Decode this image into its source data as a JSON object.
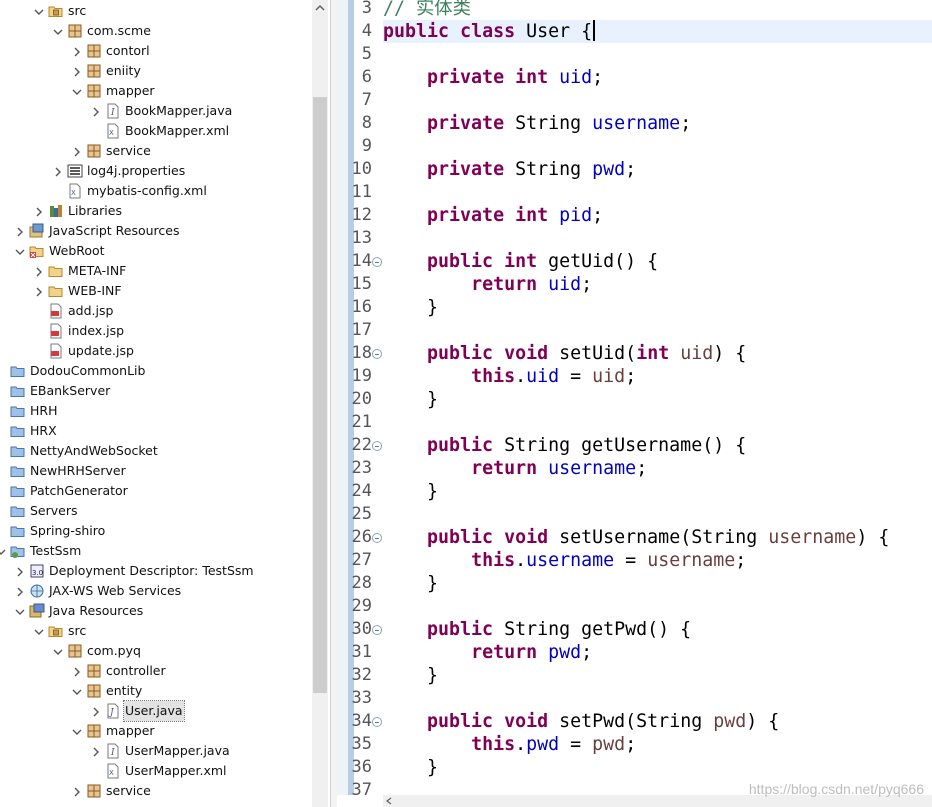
{
  "explorer": {
    "rows": [
      {
        "label": "src",
        "icon": "package-folder",
        "expanded": true,
        "depth": 2
      },
      {
        "label": "com.scme",
        "icon": "package",
        "expanded": true,
        "depth": 3
      },
      {
        "label": "contorl",
        "icon": "package",
        "expanded": false,
        "depth": 4
      },
      {
        "label": "eniity",
        "icon": "package",
        "expanded": false,
        "depth": 4
      },
      {
        "label": "mapper",
        "icon": "package",
        "expanded": true,
        "depth": 4
      },
      {
        "label": "BookMapper.java",
        "icon": "java-interface-file",
        "expanded": false,
        "depth": 5
      },
      {
        "label": "BookMapper.xml",
        "icon": "xml-file",
        "expanded": null,
        "depth": 5
      },
      {
        "label": "service",
        "icon": "package",
        "expanded": false,
        "depth": 4
      },
      {
        "label": "log4j.properties",
        "icon": "properties-file",
        "expanded": false,
        "depth": 3
      },
      {
        "label": "mybatis-config.xml",
        "icon": "xml-file",
        "expanded": null,
        "depth": 3
      },
      {
        "label": "Libraries",
        "icon": "libraries",
        "expanded": false,
        "depth": 2
      },
      {
        "label": "JavaScript Resources",
        "icon": "javascript-resources",
        "expanded": false,
        "depth": 1
      },
      {
        "label": "WebRoot",
        "icon": "folder-error",
        "expanded": true,
        "depth": 1
      },
      {
        "label": "META-INF",
        "icon": "folder",
        "expanded": false,
        "depth": 2
      },
      {
        "label": "WEB-INF",
        "icon": "folder",
        "expanded": false,
        "depth": 2
      },
      {
        "label": "add.jsp",
        "icon": "jsp-file",
        "expanded": null,
        "depth": 2
      },
      {
        "label": "index.jsp",
        "icon": "jsp-file",
        "expanded": null,
        "depth": 2
      },
      {
        "label": "update.jsp",
        "icon": "jsp-file",
        "expanded": null,
        "depth": 2
      },
      {
        "label": "DodouCommonLib",
        "icon": "project",
        "expanded": null,
        "depth": 0
      },
      {
        "label": "EBankServer",
        "icon": "project",
        "expanded": null,
        "depth": 0
      },
      {
        "label": "HRH",
        "icon": "project",
        "expanded": null,
        "depth": 0
      },
      {
        "label": "HRX",
        "icon": "project",
        "expanded": null,
        "depth": 0
      },
      {
        "label": "NettyAndWebSocket",
        "icon": "project",
        "expanded": null,
        "depth": 0
      },
      {
        "label": "NewHRHServer",
        "icon": "project",
        "expanded": null,
        "depth": 0
      },
      {
        "label": "PatchGenerator",
        "icon": "project",
        "expanded": null,
        "depth": 0
      },
      {
        "label": "Servers",
        "icon": "project",
        "expanded": null,
        "depth": 0
      },
      {
        "label": "Spring-shiro",
        "icon": "project",
        "expanded": null,
        "depth": 0
      },
      {
        "label": "TestSsm",
        "icon": "web-project",
        "expanded": true,
        "depth": 0
      },
      {
        "label": "Deployment Descriptor: TestSsm",
        "icon": "deployment-descriptor",
        "expanded": false,
        "depth": 1
      },
      {
        "label": "JAX-WS Web Services",
        "icon": "web-services",
        "expanded": false,
        "depth": 1
      },
      {
        "label": "Java Resources",
        "icon": "java-resources",
        "expanded": true,
        "depth": 1
      },
      {
        "label": "src",
        "icon": "package-folder",
        "expanded": true,
        "depth": 2
      },
      {
        "label": "com.pyq",
        "icon": "package",
        "expanded": true,
        "depth": 3
      },
      {
        "label": "controller",
        "icon": "package",
        "expanded": false,
        "depth": 4
      },
      {
        "label": "entity",
        "icon": "package",
        "expanded": true,
        "depth": 4
      },
      {
        "label": "User.java",
        "icon": "java-file",
        "expanded": false,
        "depth": 5,
        "selected": true
      },
      {
        "label": "mapper",
        "icon": "package",
        "expanded": true,
        "depth": 4
      },
      {
        "label": "UserMapper.java",
        "icon": "java-interface-file",
        "expanded": false,
        "depth": 5
      },
      {
        "label": "UserMapper.xml",
        "icon": "xml-file",
        "expanded": null,
        "depth": 5
      },
      {
        "label": "service",
        "icon": "package",
        "expanded": false,
        "depth": 4
      }
    ]
  },
  "editor": {
    "cursor_line": 4,
    "lines": [
      {
        "n": 3,
        "fold": false,
        "tokens": [
          [
            "cm",
            "// 实体类"
          ]
        ]
      },
      {
        "n": 4,
        "fold": false,
        "tokens": [
          [
            "kw",
            "public"
          ],
          [
            "t",
            " "
          ],
          [
            "kw",
            "class"
          ],
          [
            "t",
            " User {"
          ]
        ]
      },
      {
        "n": 5,
        "fold": false,
        "tokens": []
      },
      {
        "n": 6,
        "fold": false,
        "tokens": [
          [
            "t",
            "    "
          ],
          [
            "kw",
            "private"
          ],
          [
            "t",
            " "
          ],
          [
            "kw",
            "int"
          ],
          [
            "t",
            " "
          ],
          [
            "fd",
            "uid"
          ],
          [
            "t",
            ";"
          ]
        ]
      },
      {
        "n": 7,
        "fold": false,
        "tokens": []
      },
      {
        "n": 8,
        "fold": false,
        "tokens": [
          [
            "t",
            "    "
          ],
          [
            "kw",
            "private"
          ],
          [
            "t",
            " String "
          ],
          [
            "fd",
            "username"
          ],
          [
            "t",
            ";"
          ]
        ]
      },
      {
        "n": 9,
        "fold": false,
        "tokens": []
      },
      {
        "n": 10,
        "fold": false,
        "tokens": [
          [
            "t",
            "    "
          ],
          [
            "kw",
            "private"
          ],
          [
            "t",
            " String "
          ],
          [
            "fd",
            "pwd"
          ],
          [
            "t",
            ";"
          ]
        ]
      },
      {
        "n": 11,
        "fold": false,
        "tokens": []
      },
      {
        "n": 12,
        "fold": false,
        "tokens": [
          [
            "t",
            "    "
          ],
          [
            "kw",
            "private"
          ],
          [
            "t",
            " "
          ],
          [
            "kw",
            "int"
          ],
          [
            "t",
            " "
          ],
          [
            "fd",
            "pid"
          ],
          [
            "t",
            ";"
          ]
        ]
      },
      {
        "n": 13,
        "fold": false,
        "tokens": []
      },
      {
        "n": 14,
        "fold": true,
        "tokens": [
          [
            "t",
            "    "
          ],
          [
            "kw",
            "public"
          ],
          [
            "t",
            " "
          ],
          [
            "kw",
            "int"
          ],
          [
            "t",
            " getUid() {"
          ]
        ]
      },
      {
        "n": 15,
        "fold": false,
        "tokens": [
          [
            "t",
            "        "
          ],
          [
            "kw",
            "return"
          ],
          [
            "t",
            " "
          ],
          [
            "fd",
            "uid"
          ],
          [
            "t",
            ";"
          ]
        ]
      },
      {
        "n": 16,
        "fold": false,
        "tokens": [
          [
            "t",
            "    }"
          ]
        ]
      },
      {
        "n": 17,
        "fold": false,
        "tokens": []
      },
      {
        "n": 18,
        "fold": true,
        "tokens": [
          [
            "t",
            "    "
          ],
          [
            "kw",
            "public"
          ],
          [
            "t",
            " "
          ],
          [
            "kw",
            "void"
          ],
          [
            "t",
            " setUid("
          ],
          [
            "kw",
            "int"
          ],
          [
            "t",
            " "
          ],
          [
            "pm",
            "uid"
          ],
          [
            "t",
            ") {"
          ]
        ]
      },
      {
        "n": 19,
        "fold": false,
        "tokens": [
          [
            "t",
            "        "
          ],
          [
            "kw",
            "this"
          ],
          [
            "t",
            "."
          ],
          [
            "fd",
            "uid"
          ],
          [
            "t",
            " = "
          ],
          [
            "pm",
            "uid"
          ],
          [
            "t",
            ";"
          ]
        ]
      },
      {
        "n": 20,
        "fold": false,
        "tokens": [
          [
            "t",
            "    }"
          ]
        ]
      },
      {
        "n": 21,
        "fold": false,
        "tokens": []
      },
      {
        "n": 22,
        "fold": true,
        "tokens": [
          [
            "t",
            "    "
          ],
          [
            "kw",
            "public"
          ],
          [
            "t",
            " String getUsername() {"
          ]
        ]
      },
      {
        "n": 23,
        "fold": false,
        "tokens": [
          [
            "t",
            "        "
          ],
          [
            "kw",
            "return"
          ],
          [
            "t",
            " "
          ],
          [
            "fd",
            "username"
          ],
          [
            "t",
            ";"
          ]
        ]
      },
      {
        "n": 24,
        "fold": false,
        "tokens": [
          [
            "t",
            "    }"
          ]
        ]
      },
      {
        "n": 25,
        "fold": false,
        "tokens": []
      },
      {
        "n": 26,
        "fold": true,
        "tokens": [
          [
            "t",
            "    "
          ],
          [
            "kw",
            "public"
          ],
          [
            "t",
            " "
          ],
          [
            "kw",
            "void"
          ],
          [
            "t",
            " setUsername(String "
          ],
          [
            "pm",
            "username"
          ],
          [
            "t",
            ") {"
          ]
        ]
      },
      {
        "n": 27,
        "fold": false,
        "tokens": [
          [
            "t",
            "        "
          ],
          [
            "kw",
            "this"
          ],
          [
            "t",
            "."
          ],
          [
            "fd",
            "username"
          ],
          [
            "t",
            " = "
          ],
          [
            "pm",
            "username"
          ],
          [
            "t",
            ";"
          ]
        ]
      },
      {
        "n": 28,
        "fold": false,
        "tokens": [
          [
            "t",
            "    }"
          ]
        ]
      },
      {
        "n": 29,
        "fold": false,
        "tokens": []
      },
      {
        "n": 30,
        "fold": true,
        "tokens": [
          [
            "t",
            "    "
          ],
          [
            "kw",
            "public"
          ],
          [
            "t",
            " String getPwd() {"
          ]
        ]
      },
      {
        "n": 31,
        "fold": false,
        "tokens": [
          [
            "t",
            "        "
          ],
          [
            "kw",
            "return"
          ],
          [
            "t",
            " "
          ],
          [
            "fd",
            "pwd"
          ],
          [
            "t",
            ";"
          ]
        ]
      },
      {
        "n": 32,
        "fold": false,
        "tokens": [
          [
            "t",
            "    }"
          ]
        ]
      },
      {
        "n": 33,
        "fold": false,
        "tokens": []
      },
      {
        "n": 34,
        "fold": true,
        "tokens": [
          [
            "t",
            "    "
          ],
          [
            "kw",
            "public"
          ],
          [
            "t",
            " "
          ],
          [
            "kw",
            "void"
          ],
          [
            "t",
            " setPwd(String "
          ],
          [
            "pm",
            "pwd"
          ],
          [
            "t",
            ") {"
          ]
        ]
      },
      {
        "n": 35,
        "fold": false,
        "tokens": [
          [
            "t",
            "        "
          ],
          [
            "kw",
            "this"
          ],
          [
            "t",
            "."
          ],
          [
            "fd",
            "pwd"
          ],
          [
            "t",
            " = "
          ],
          [
            "pm",
            "pwd"
          ],
          [
            "t",
            ";"
          ]
        ]
      },
      {
        "n": 36,
        "fold": false,
        "tokens": [
          [
            "t",
            "    }"
          ]
        ]
      },
      {
        "n": 37,
        "fold": false,
        "tokens": []
      }
    ]
  },
  "watermark": "https://blog.csdn.net/pyq666",
  "colors": {
    "keyword": "#7f0055",
    "field": "#0000c0",
    "param": "#6a3e3e",
    "comment": "#3f7f5f",
    "current_line": "#e8f2fe",
    "selection": "#e3e3e3",
    "scrollbar_thumb": "#cdcdcd",
    "gutter_bar": "#b5cde6"
  }
}
